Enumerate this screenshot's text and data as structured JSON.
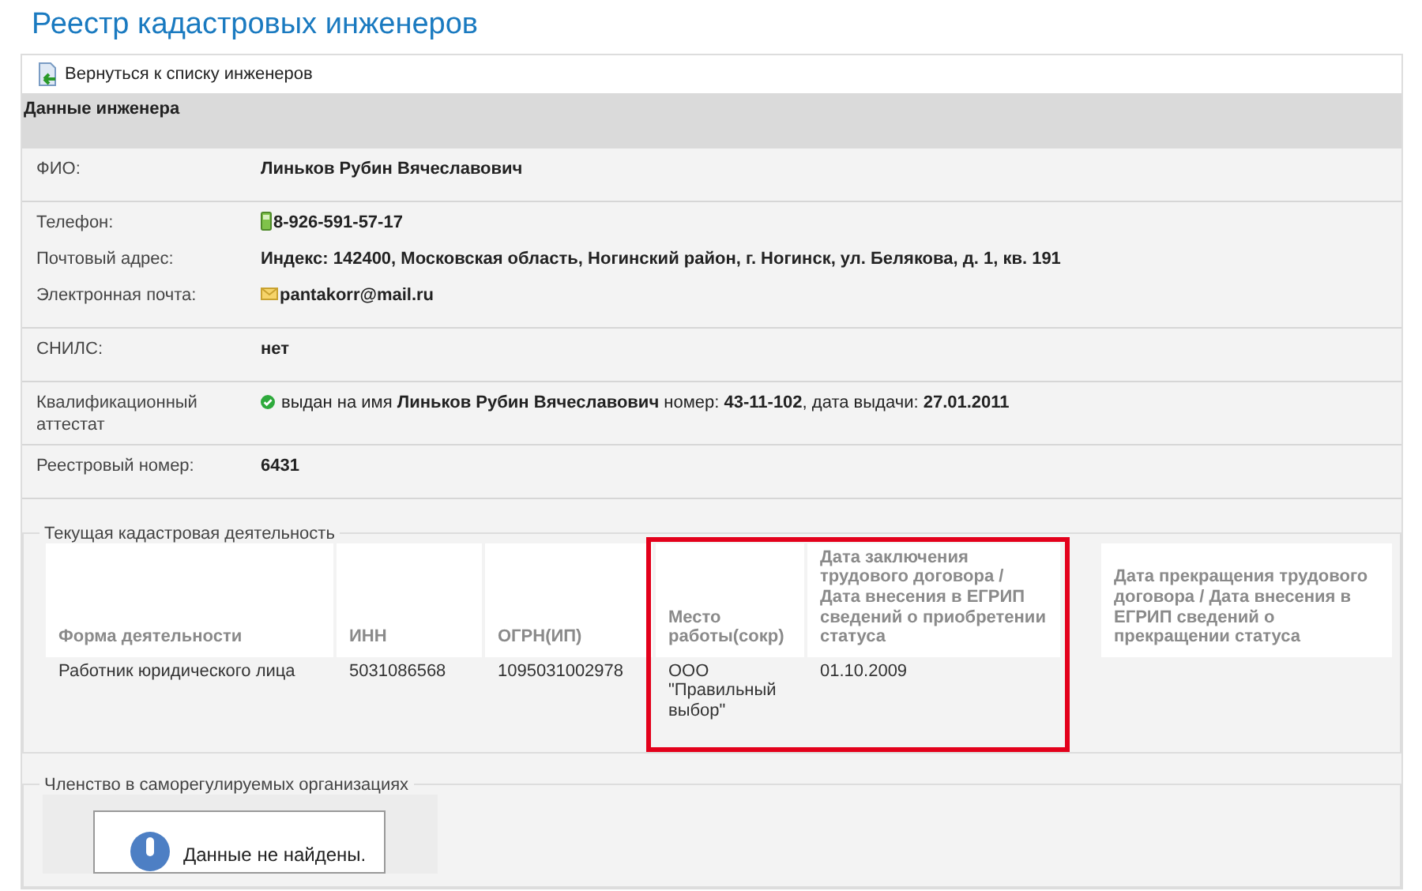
{
  "page_title": "Реестр кадастровых инженеров",
  "back_link": "Вернуться к списку инженеров",
  "section_title": "Данные инженера",
  "field_groups": [
    [
      {
        "label": "ФИО:",
        "value": "Линьков Рубин Вячеславович",
        "kind": "text"
      }
    ],
    [
      {
        "label": "Телефон:",
        "value": "8-926-591-57-17",
        "kind": "phone"
      },
      {
        "label": "Почтовый адрес:",
        "value": "Индекс: 142400, Московская область, Ногинский район, г. Ногинск, ул. Белякова, д. 1, кв. 191",
        "kind": "text"
      },
      {
        "label": "Электронная почта:",
        "value": "pantakorr@mail.ru",
        "kind": "email"
      }
    ],
    [
      {
        "label": "СНИЛС:",
        "value": "нет",
        "kind": "text"
      }
    ],
    [
      {
        "label": "Квалификационный аттестат",
        "value": "выдан на имя **Линьков Рубин Вячеславович** номер: **43-11-102**, дата выдачи: **27.01.2011**",
        "kind": "certificate"
      }
    ],
    [
      {
        "label": "Реестровый номер:",
        "value": "6431",
        "kind": "text"
      }
    ]
  ],
  "activity": {
    "legend": "Текущая кадастровая деятельность",
    "columns": [
      {
        "title": "Форма деятельности",
        "highlighted": false
      },
      {
        "title": "ИНН",
        "highlighted": false
      },
      {
        "title": "ОГРН(ИП)",
        "highlighted": false
      },
      {
        "title": "Место работы(сокр)",
        "highlighted": true
      },
      {
        "title": "Дата заключения трудового договора / Дата внесения в ЕГРИП сведений о приобретении статуса",
        "highlighted": true
      },
      {
        "title": "Дата прекращения трудового договора / Дата внесения в ЕГРИП сведений о прекращении статуса",
        "highlighted": false
      }
    ],
    "rows": [
      [
        "Работник юридического лица",
        "5031086568",
        "1095031002978",
        "ООО \"Правильный выбор\"",
        "01.10.2009",
        ""
      ]
    ]
  },
  "membership": {
    "legend": "Членство в саморегулируемых организациях",
    "message": "Данные не найдены."
  }
}
